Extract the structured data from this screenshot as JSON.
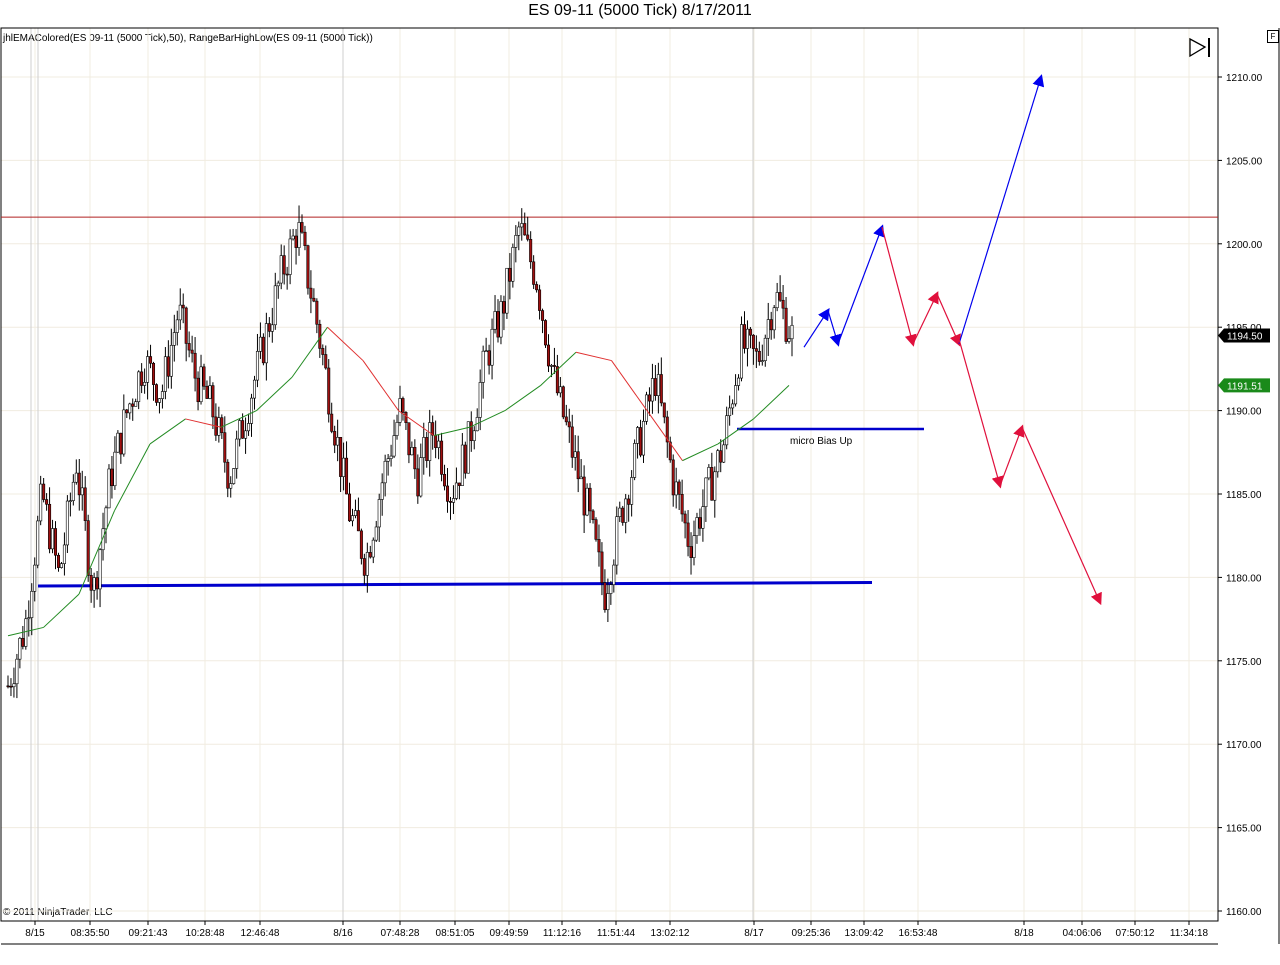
{
  "title": "ES 09-11 (5000 Tick)  8/17/2011",
  "indicator_label": "jhlEMAColored(ES 09-11 (5000 Tick),50), RangeBarHighLow(ES 09-11 (5000 Tick))",
  "copyright": "© 2011 NinjaTrader, LLC",
  "f_button": "F",
  "play_icon": "play-to-end-icon",
  "colors": {
    "bull_candle": "#ffffff",
    "bear_candle": "#a01010",
    "wick": "#000000",
    "ema_up": "#228b22",
    "ema_down": "#e03030",
    "support_line": "#0000cc",
    "resistance_line": "#b02020",
    "bull_arrow": "#0000ee",
    "bear_arrow": "#e0103c",
    "last_price_bg": "#000000",
    "ema_price_bg": "#1a8a1a"
  },
  "chart_data": {
    "type": "candlestick",
    "ylim": [
      1159.5,
      1212.8
    ],
    "y_ticks": [
      "1210.00",
      "1205.00",
      "1200.00",
      "1195.00",
      "1190.00",
      "1185.00",
      "1180.00",
      "1175.00",
      "1170.00",
      "1165.00",
      "1160.00"
    ],
    "x_tick_labels": [
      "8/15",
      "08:35:50",
      "09:21:43",
      "10:28:48",
      "12:46:48",
      "8/16",
      "07:48:28",
      "08:51:05",
      "09:49:59",
      "11:12:16",
      "11:51:44",
      "13:02:12",
      "8/17",
      "09:25:36",
      "13:09:42",
      "16:53:48",
      "8/18",
      "04:06:06",
      "07:50:12",
      "11:34:18"
    ],
    "price_path": [
      1173.5,
      1177,
      1185,
      1180,
      1187,
      1179,
      1186,
      1190,
      1193,
      1191,
      1196,
      1192,
      1190,
      1186,
      1190,
      1194,
      1198,
      1201,
      1196,
      1190,
      1184,
      1181,
      1186,
      1190,
      1186,
      1189,
      1185,
      1188,
      1193,
      1196,
      1201,
      1198,
      1192,
      1188,
      1184,
      1179,
      1184,
      1188,
      1192,
      1186,
      1182,
      1185,
      1188,
      1194,
      1193,
      1197,
      1194.5
    ],
    "ema_path": [
      1176.5,
      1177,
      1179,
      1184,
      1188,
      1189.5,
      1189,
      1190,
      1192,
      1195,
      1193,
      1190,
      1188.5,
      1189,
      1190,
      1191.5,
      1193.5,
      1193,
      1190,
      1187,
      1188,
      1189.5,
      1191.51
    ],
    "last_price": "1194.50",
    "ema_price": "1191.51",
    "resistance_line": 1201.6,
    "support_line": 1179.7,
    "micro_support_line": 1188.9,
    "annotation": "micro Bias Up",
    "projected_bull_path": [
      1193.8,
      1196,
      1194,
      1201,
      1194,
      1200.5,
      1210
    ],
    "projected_bear_path": [
      1195,
      1185.5,
      1189,
      1178.5
    ]
  }
}
